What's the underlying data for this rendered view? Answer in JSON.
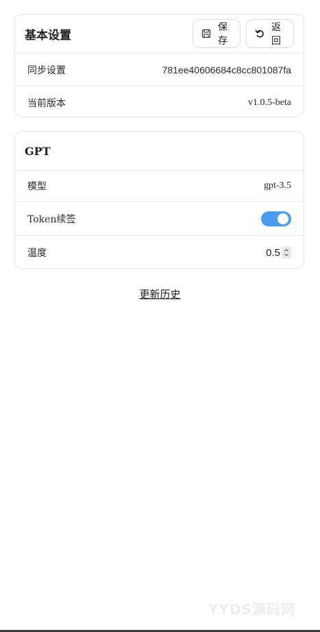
{
  "basic_settings": {
    "title": "基本设置",
    "save_label": "保存",
    "back_label": "返回",
    "rows": [
      {
        "label": "同步设置",
        "value": "781ee40606684c8cc801087fa"
      },
      {
        "label": "当前版本",
        "value": "v1.0.5-beta"
      }
    ]
  },
  "gpt": {
    "title": "GPT",
    "model": {
      "label": "模型",
      "value": "gpt-3.5"
    },
    "token_renew": {
      "label": "Token续签",
      "enabled": true
    },
    "temperature": {
      "label": "温度",
      "value": "0.5"
    }
  },
  "history_link": "更新历史",
  "watermark": "YYDS源码网",
  "colors": {
    "accent": "#4a9cf1",
    "border": "#e3e3e3"
  },
  "icons": {
    "save": "save-icon",
    "back": "undo-icon"
  }
}
